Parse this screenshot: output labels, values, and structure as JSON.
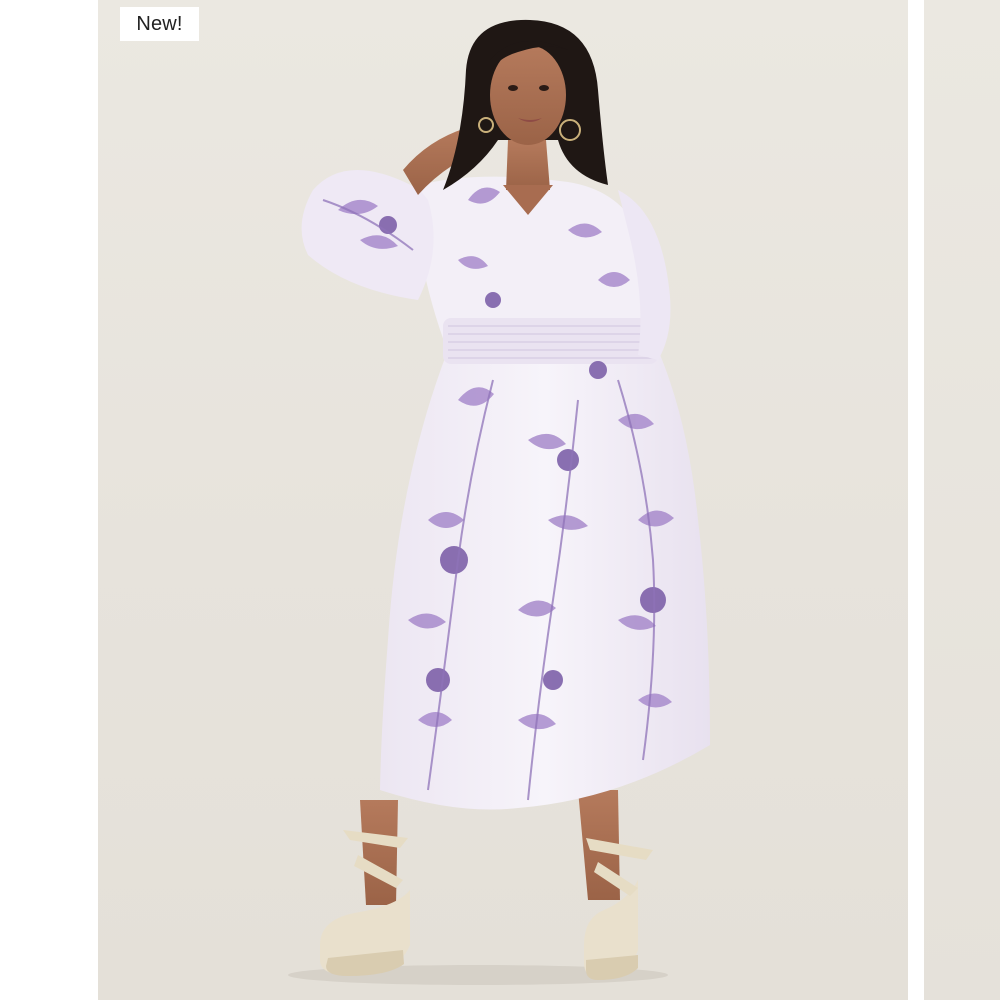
{
  "product_card": {
    "badge_label": "New!",
    "image": {
      "subject": "model-wearing-lavender-floral-midi-dress",
      "background_color": "#e8e4dd",
      "dress_base_color": "#f4f0f7",
      "print_color": "#9b7cc4",
      "print_dark_color": "#6f5596",
      "shoe_color": "#e6dcc7"
    },
    "next_image_peek": {
      "background_color": "#e8e4dd"
    }
  }
}
